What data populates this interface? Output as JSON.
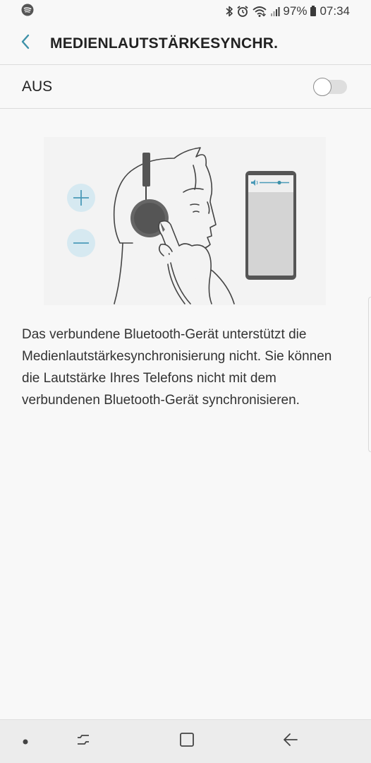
{
  "status_bar": {
    "app_notification_icon": "spotify-icon",
    "icons": [
      "bluetooth-icon",
      "alarm-icon",
      "wifi-icon",
      "signal-icon"
    ],
    "battery_percent": "97%",
    "battery_icon": "battery-icon",
    "time": "07:34"
  },
  "header": {
    "back_icon": "chevron-left-icon",
    "title": "MEDIENLAUTSTÄRKESYNCHR."
  },
  "toggle": {
    "label": "AUS",
    "state": "off"
  },
  "illustration": {
    "depicts": [
      "volume-plus-icon",
      "volume-minus-icon",
      "headphones",
      "phone-volume-slider"
    ]
  },
  "description": "Das verbundene Bluetooth-Gerät unterstützt die Medienlautstärkesynchronisierung nicht. Sie können die Lautstärke Ihres Telefons nicht mit dem verbundenen Bluetooth-Gerät synchronisieren.",
  "nav_bar": {
    "items": [
      "dot-indicator",
      "recents-icon",
      "home-icon",
      "back-arrow-icon"
    ]
  },
  "colors": {
    "accent": "#3e91a8",
    "background": "#f8f8f8",
    "nav_background": "#ececec",
    "illustration_circle": "#d6e9f1",
    "illustration_circle_stroke": "#4a9ab8"
  }
}
